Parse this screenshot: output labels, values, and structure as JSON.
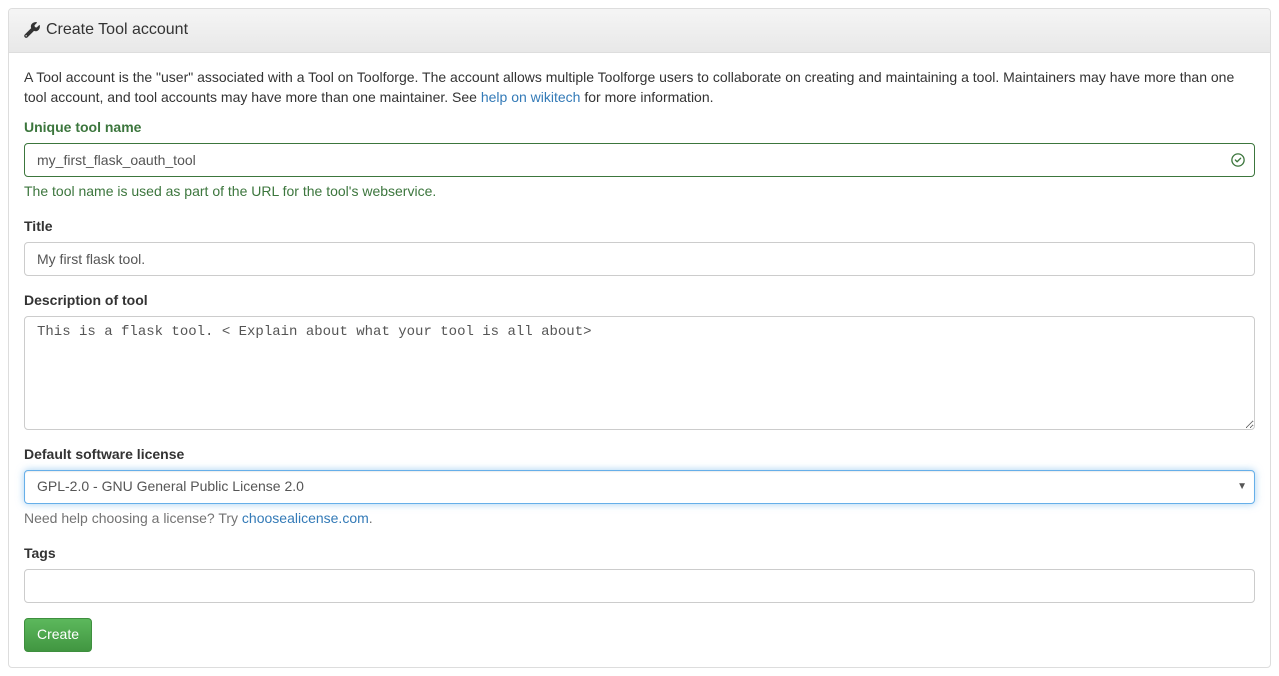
{
  "panel": {
    "title": "Create Tool account"
  },
  "intro": {
    "text_before_link": "A Tool account is the \"user\" associated with a Tool on Toolforge. The account allows multiple Toolforge users to collaborate on creating and maintaining a tool. Maintainers may have more than one tool account, and tool accounts may have more than one maintainer. See ",
    "link_text": "help on wikitech",
    "text_after_link": " for more information."
  },
  "form": {
    "tool_name": {
      "label": "Unique tool name",
      "value": "my_first_flask_oauth_tool",
      "help": "The tool name is used as part of the URL for the tool's webservice."
    },
    "title": {
      "label": "Title",
      "value": "My first flask tool."
    },
    "description": {
      "label": "Description of tool",
      "value": "This is a flask tool. < Explain about what your tool is all about>"
    },
    "license": {
      "label": "Default software license",
      "selected": "GPL-2.0 - GNU General Public License 2.0",
      "help_before": "Need help choosing a license? Try ",
      "help_link": "choosealicense.com",
      "help_after": "."
    },
    "tags": {
      "label": "Tags",
      "value": ""
    },
    "submit": "Create"
  }
}
